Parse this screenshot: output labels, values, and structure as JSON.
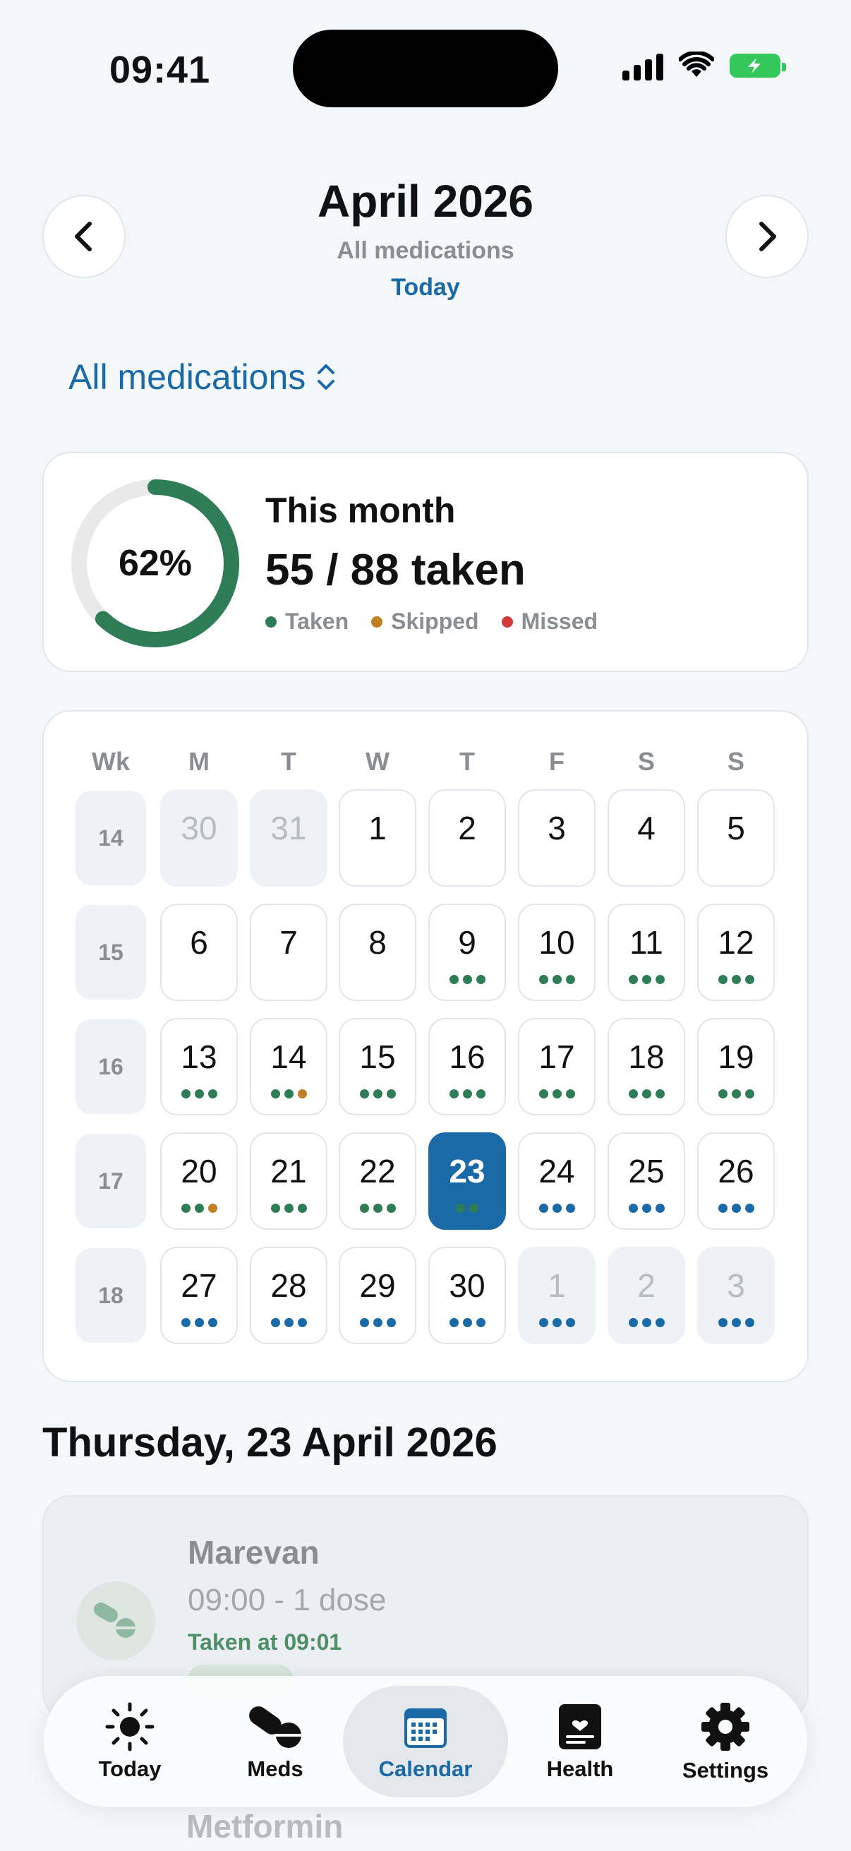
{
  "status_bar": {
    "time": "09:41"
  },
  "header": {
    "title": "April 2026",
    "subtitle": "All medications",
    "today_label": "Today",
    "prev_icon": "chevron-left-icon",
    "next_icon": "chevron-right-icon"
  },
  "filter": {
    "label": "All medications"
  },
  "summary": {
    "percent_label": "62%",
    "percent_value": 0.62,
    "title": "This month",
    "count": "55 / 88 taken",
    "legend": [
      {
        "label": "Taken",
        "color": "#2e7d57"
      },
      {
        "label": "Skipped",
        "color": "#c07f22"
      },
      {
        "label": "Missed",
        "color": "#d13b3b"
      }
    ]
  },
  "colors": {
    "taken": "#2e7d57",
    "skipped": "#c07f22",
    "missed": "#d13b3b",
    "scheduled": "#1a6aa8",
    "accent": "#1a6aa8"
  },
  "calendar": {
    "headers": [
      "Wk",
      "M",
      "T",
      "W",
      "T",
      "F",
      "S",
      "S"
    ],
    "weeks": [
      {
        "wk": "14",
        "days": [
          {
            "num": "30",
            "outside": true,
            "dots": []
          },
          {
            "num": "31",
            "outside": true,
            "dots": []
          },
          {
            "num": "1",
            "dots": []
          },
          {
            "num": "2",
            "dots": []
          },
          {
            "num": "3",
            "dots": []
          },
          {
            "num": "4",
            "dots": []
          },
          {
            "num": "5",
            "dots": []
          }
        ]
      },
      {
        "wk": "15",
        "days": [
          {
            "num": "6",
            "dots": []
          },
          {
            "num": "7",
            "dots": []
          },
          {
            "num": "8",
            "dots": []
          },
          {
            "num": "9",
            "dots": [
              "taken",
              "taken",
              "taken"
            ]
          },
          {
            "num": "10",
            "dots": [
              "taken",
              "taken",
              "taken"
            ]
          },
          {
            "num": "11",
            "dots": [
              "taken",
              "taken",
              "taken"
            ]
          },
          {
            "num": "12",
            "dots": [
              "taken",
              "taken",
              "taken"
            ]
          }
        ]
      },
      {
        "wk": "16",
        "days": [
          {
            "num": "13",
            "dots": [
              "taken",
              "taken",
              "taken"
            ]
          },
          {
            "num": "14",
            "dots": [
              "taken",
              "taken",
              "skipped"
            ]
          },
          {
            "num": "15",
            "dots": [
              "taken",
              "taken",
              "taken"
            ]
          },
          {
            "num": "16",
            "dots": [
              "taken",
              "taken",
              "taken"
            ]
          },
          {
            "num": "17",
            "dots": [
              "taken",
              "taken",
              "taken"
            ]
          },
          {
            "num": "18",
            "dots": [
              "taken",
              "taken",
              "taken"
            ]
          },
          {
            "num": "19",
            "dots": [
              "taken",
              "taken",
              "taken"
            ]
          }
        ]
      },
      {
        "wk": "17",
        "days": [
          {
            "num": "20",
            "dots": [
              "taken",
              "taken",
              "skipped"
            ]
          },
          {
            "num": "21",
            "dots": [
              "taken",
              "taken",
              "taken"
            ]
          },
          {
            "num": "22",
            "dots": [
              "taken",
              "taken",
              "taken"
            ]
          },
          {
            "num": "23",
            "selected": true,
            "dots": [
              "taken",
              "taken"
            ]
          },
          {
            "num": "24",
            "dots": [
              "scheduled",
              "scheduled",
              "scheduled"
            ]
          },
          {
            "num": "25",
            "dots": [
              "scheduled",
              "scheduled",
              "scheduled"
            ]
          },
          {
            "num": "26",
            "dots": [
              "scheduled",
              "scheduled",
              "scheduled"
            ]
          }
        ]
      },
      {
        "wk": "18",
        "days": [
          {
            "num": "27",
            "dots": [
              "scheduled",
              "scheduled",
              "scheduled"
            ]
          },
          {
            "num": "28",
            "dots": [
              "scheduled",
              "scheduled",
              "scheduled"
            ]
          },
          {
            "num": "29",
            "dots": [
              "scheduled",
              "scheduled",
              "scheduled"
            ]
          },
          {
            "num": "30",
            "dots": [
              "scheduled",
              "scheduled",
              "scheduled"
            ]
          },
          {
            "num": "1",
            "outside": true,
            "dots": [
              "scheduled",
              "scheduled",
              "scheduled"
            ]
          },
          {
            "num": "2",
            "outside": true,
            "dots": [
              "scheduled",
              "scheduled",
              "scheduled"
            ]
          },
          {
            "num": "3",
            "outside": true,
            "dots": [
              "scheduled",
              "scheduled",
              "scheduled"
            ]
          }
        ]
      }
    ]
  },
  "selected_date": {
    "heading": "Thursday, 23 April 2026"
  },
  "doses": [
    {
      "name": "Marevan",
      "time": "09:00 - 1 dose",
      "status": "Taken at 09:01",
      "icon": "pill-icon"
    },
    {
      "name": "Metformin"
    }
  ],
  "tabbar": {
    "items": [
      {
        "label": "Today",
        "icon": "sun-icon"
      },
      {
        "label": "Meds",
        "icon": "pills-icon"
      },
      {
        "label": "Calendar",
        "icon": "calendar-icon",
        "active": true
      },
      {
        "label": "Health",
        "icon": "health-record-icon"
      },
      {
        "label": "Settings",
        "icon": "gear-icon"
      }
    ]
  }
}
